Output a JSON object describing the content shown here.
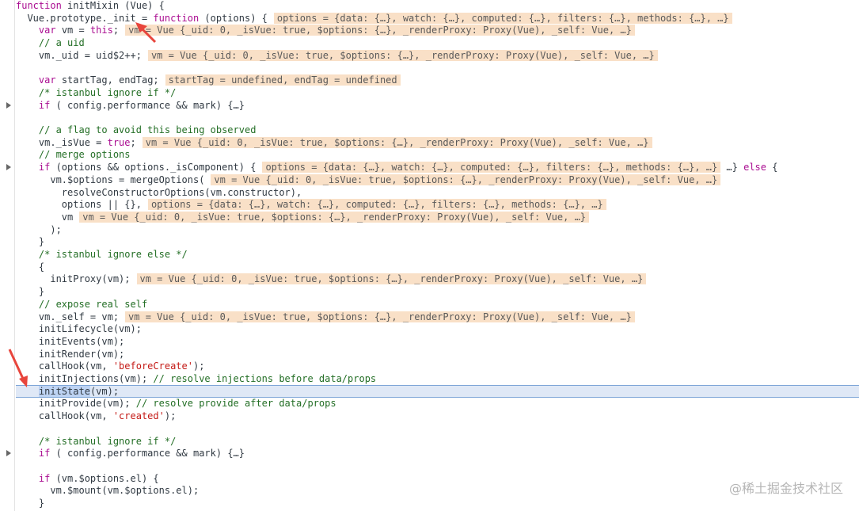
{
  "colors": {
    "keyword": "#aa0d91",
    "comment": "#236e25",
    "string": "#c41a16",
    "inline_value_bg": "#f9e0c7",
    "active_line_bg": "#dfe8f6",
    "arrow": "#e8453c"
  },
  "lines": [
    {
      "t": "function initMixin (Vue) {"
    },
    {
      "t": "  Vue.prototype._init = function (options) {",
      "v": "options = {data: {…}, watch: {…}, computed: {…}, filters: {…}, methods: {…}, …}"
    },
    {
      "t": "    var vm = this;",
      "v": "vm = Vue {_uid: 0, _isVue: true, $options: {…}, _renderProxy: Proxy(Vue), _self: Vue, …}"
    },
    {
      "t": "    // a uid",
      "c": true
    },
    {
      "t": "    vm._uid = uid$2++;",
      "v": "vm = Vue {_uid: 0, _isVue: true, $options: {…}, _renderProxy: Proxy(Vue), _self: Vue, …}"
    },
    {
      "t": ""
    },
    {
      "t": "    var startTag, endTag;",
      "v": "startTag = undefined, endTag = undefined"
    },
    {
      "t": "    /* istanbul ignore if */",
      "c": true
    },
    {
      "t": "    if ( config.performance && mark) {…}"
    },
    {
      "t": ""
    },
    {
      "t": "    // a flag to avoid this being observed",
      "c": true
    },
    {
      "t": "    vm._isVue = true;",
      "v": "vm = Vue {_uid: 0, _isVue: true, $options: {…}, _renderProxy: Proxy(Vue), _self: Vue, …}"
    },
    {
      "t": "    // merge options",
      "c": true
    },
    {
      "t": "    if (options && options._isComponent) {",
      "v": "options = {data: {…}, watch: {…}, computed: {…}, filters: {…}, methods: {…}, …}",
      "after": " …} else {"
    },
    {
      "t": "      vm.$options = mergeOptions(",
      "v": "vm = Vue {_uid: 0, _isVue: true, $options: {…}, _renderProxy: Proxy(Vue), _self: Vue, …}"
    },
    {
      "t": "        resolveConstructorOptions(vm.constructor),"
    },
    {
      "t": "        options || {},",
      "v": "options = {data: {…}, watch: {…}, computed: {…}, filters: {…}, methods: {…}, …}"
    },
    {
      "t": "        vm",
      "v": "vm = Vue {_uid: 0, _isVue: true, $options: {…}, _renderProxy: Proxy(Vue), _self: Vue, …}"
    },
    {
      "t": "      );"
    },
    {
      "t": "    }"
    },
    {
      "t": "    /* istanbul ignore else */",
      "c": true
    },
    {
      "t": "    {"
    },
    {
      "t": "      initProxy(vm);",
      "v": "vm = Vue {_uid: 0, _isVue: true, $options: {…}, _renderProxy: Proxy(Vue), _self: Vue, …}"
    },
    {
      "t": "    }"
    },
    {
      "t": "    // expose real self",
      "c": true
    },
    {
      "t": "    vm._self = vm;",
      "v": "vm = Vue {_uid: 0, _isVue: true, $options: {…}, _renderProxy: Proxy(Vue), _self: Vue, …}"
    },
    {
      "t": "    initLifecycle(vm);"
    },
    {
      "t": "    initEvents(vm);"
    },
    {
      "t": "    initRender(vm);"
    },
    {
      "t": "    callHook(vm, 'beforeCreate');"
    },
    {
      "t": "    initInjections(vm); // resolve injections before data/props"
    },
    {
      "t": "    initState(vm);",
      "active": true
    },
    {
      "t": "    initProvide(vm); // resolve provide after data/props"
    },
    {
      "t": "    callHook(vm, 'created');"
    },
    {
      "t": ""
    },
    {
      "t": "    /* istanbul ignore if */",
      "c": true
    },
    {
      "t": "    if ( config.performance && mark) {…}"
    },
    {
      "t": ""
    },
    {
      "t": "    if (vm.$options.el) {"
    },
    {
      "t": "      vm.$mount(vm.$options.el);"
    },
    {
      "t": "    }"
    }
  ],
  "fold_markers": [
    8,
    13,
    36
  ],
  "watermark": "@稀土掘金技术社区"
}
